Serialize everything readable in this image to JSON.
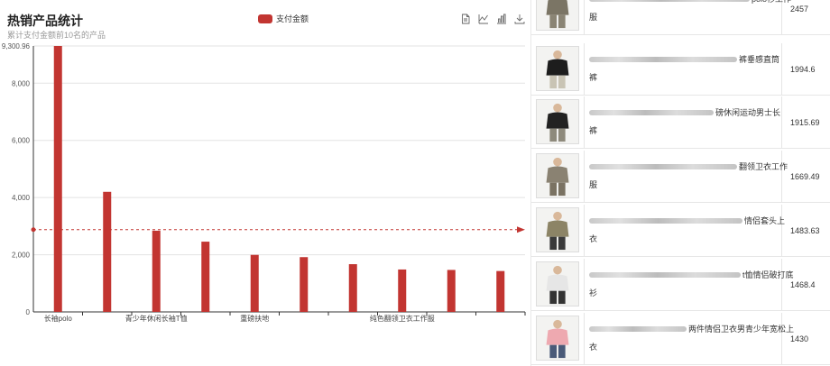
{
  "chart": {
    "title": "热销产品统计",
    "subtitle": "累计支付金额前10名的产品",
    "legend_label": "支付金额",
    "accent_color": "#c23531",
    "toolbox_icons": [
      "data-view-icon",
      "line-chart-icon",
      "bar-chart-icon",
      "download-icon"
    ]
  },
  "chart_data": {
    "type": "bar",
    "title": "热销产品统计",
    "subtitle": "累计支付金额前10名的产品",
    "categories": [
      "长袖polo",
      "",
      "青少年休闲长袖T恤",
      "",
      "重磅扶地",
      "",
      "",
      "纯色翻领卫衣工作服",
      "",
      ""
    ],
    "series": [
      {
        "name": "支付金额",
        "values": [
          9300.96,
          4200,
          2840,
          2457,
          1994.6,
          1915.69,
          1669.49,
          1483.63,
          1468.4,
          1430
        ]
      }
    ],
    "ylim": [
      0,
      9300.96
    ],
    "y_ticks": [
      "0",
      "2,000",
      "4,000",
      "6,000",
      "8,000",
      "9,300.96"
    ],
    "average_line": 2876,
    "grid": true,
    "legend_position": "top-center"
  },
  "table": {
    "rows": [
      {
        "name_end": "polo衫工作",
        "name_line2": "服",
        "amount": "2457",
        "colors": [
          "#7b7565",
          "#8a8474"
        ]
      },
      {
        "name_end": "裤垂感直筒",
        "name_line2": "裤",
        "amount": "1994.6",
        "colors": [
          "#1d1d1d",
          "#c9c4b4"
        ]
      },
      {
        "name_end": "磅休闲运动男士长",
        "name_line2": "裤",
        "amount": "1915.69",
        "colors": [
          "#222222",
          "#8e8a7c"
        ]
      },
      {
        "name_end": "翻领卫衣工作",
        "name_line2": "服",
        "amount": "1669.49",
        "colors": [
          "#8a8272",
          "#7a7262"
        ]
      },
      {
        "name_end": "情侣套头上",
        "name_line2": "衣",
        "amount": "1483.63",
        "colors": [
          "#8c8466",
          "#3a3a3a"
        ]
      },
      {
        "name_end": "t恤情侣破打底",
        "name_line2": "衫",
        "amount": "1468.4",
        "colors": [
          "#e6e6e6",
          "#333333"
        ]
      },
      {
        "name_end": "两件情侣卫衣男青少年宽松上",
        "name_line2": "衣",
        "amount": "1430",
        "colors": [
          "#eea9b0",
          "#4a5a78"
        ]
      }
    ]
  }
}
